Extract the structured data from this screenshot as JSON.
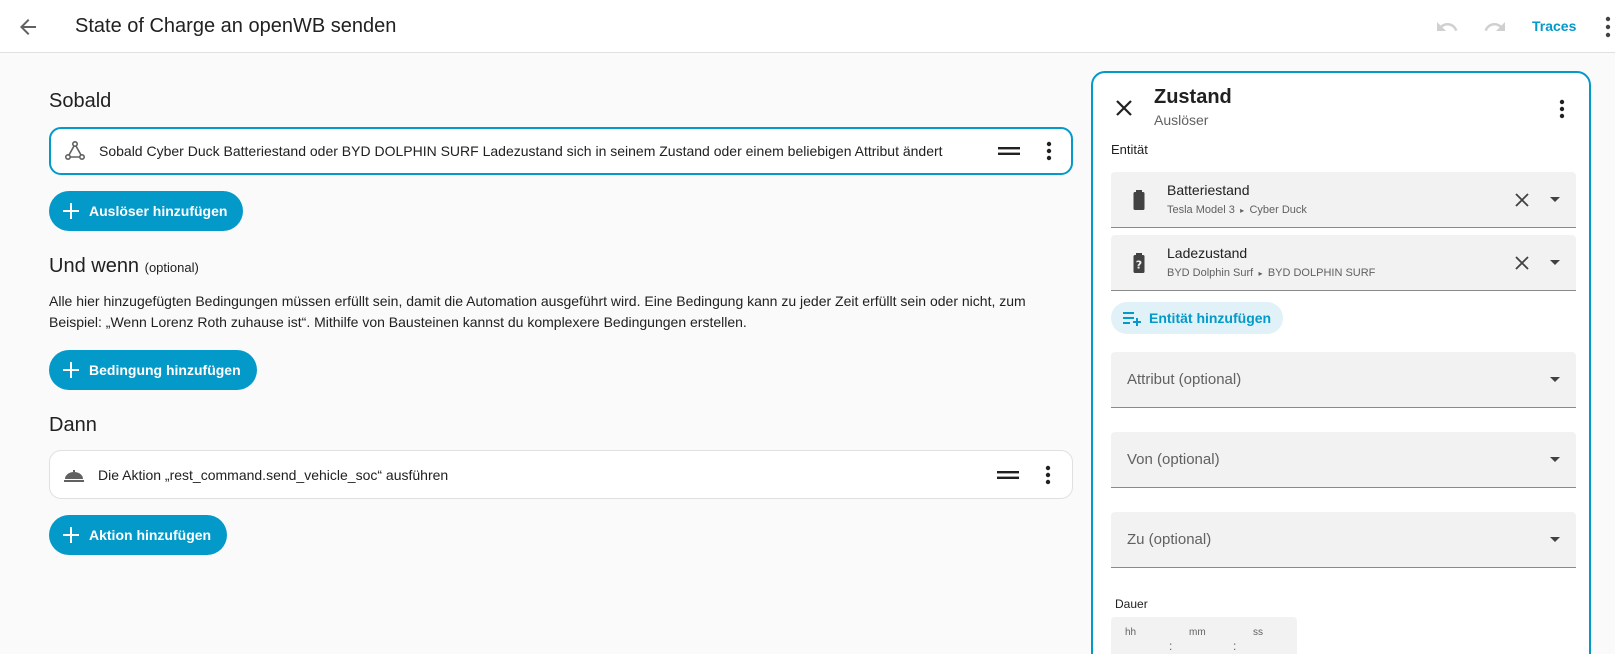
{
  "header": {
    "title": "State of Charge an openWB senden",
    "traces_label": "Traces"
  },
  "triggers": {
    "heading": "Sobald",
    "items": [
      {
        "text": "Sobald Cyber Duck Batteriestand oder BYD DOLPHIN SURF Ladezustand sich in seinem Zustand oder einem beliebigen Attribut ändert"
      }
    ],
    "add_label": "Auslöser hinzufügen"
  },
  "conditions": {
    "heading": "Und wenn",
    "optional": "(optional)",
    "description": "Alle hier hinzugefügten Bedingungen müssen erfüllt sein, damit die Automation ausgeführt wird. Eine Bedingung kann zu jeder Zeit erfüllt sein oder nicht, zum Beispiel: „Wenn Lorenz Roth zuhause ist“. Mithilfe von Bausteinen kannst du komplexere Bedingungen erstellen.",
    "add_label": "Bedingung hinzufügen"
  },
  "actions": {
    "heading": "Dann",
    "items": [
      {
        "text": "Die Aktion „rest_command.send_vehicle_soc“ ausführen"
      }
    ],
    "add_label": "Aktion hinzufügen"
  },
  "panel": {
    "title": "Zustand",
    "subtitle": "Auslöser",
    "entity_label": "Entität",
    "entities": [
      {
        "name": "Batteriestand",
        "device": "Tesla Model 3",
        "area": "Cyber Duck",
        "icon": "battery-icon"
      },
      {
        "name": "Ladezustand",
        "device": "BYD Dolphin Surf",
        "area": "BYD DOLPHIN SURF",
        "icon": "battery-unknown-icon"
      }
    ],
    "add_entity_label": "Entität hinzufügen",
    "attribute_label": "Attribut (optional)",
    "from_label": "Von (optional)",
    "to_label": "Zu (optional)",
    "duration_label": "Dauer",
    "duration_parts": {
      "hours": "hh",
      "minutes": "mm",
      "seconds": "ss"
    },
    "duration_separator": ":"
  },
  "colors": {
    "accent": "#0399c9",
    "accent_light": "#e0f1f8",
    "field_bg": "#f2f2f2"
  }
}
